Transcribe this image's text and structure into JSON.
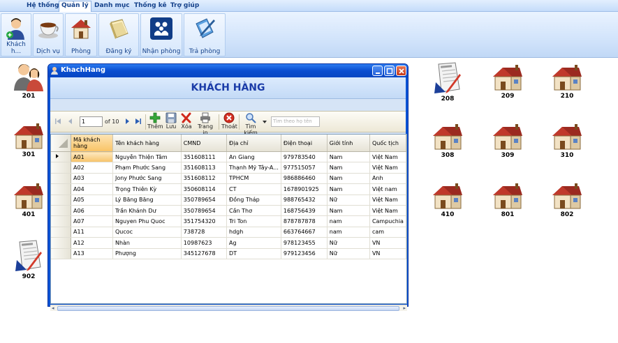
{
  "menu": [
    "Hệ thống",
    "Quản lý",
    "Danh mục",
    "Thống kê",
    "Trợ giúp"
  ],
  "menu_active": "Quản lý",
  "ribbon": [
    {
      "label": "Khách h...",
      "icon": "customer-add-icon"
    },
    {
      "label": "Dịch vụ",
      "icon": "coffee-cup-icon"
    },
    {
      "label": "Phòng",
      "icon": "house-icon"
    },
    {
      "label": "Đăng ký",
      "icon": "book-icon"
    },
    {
      "label": "Nhận phòng",
      "icon": "people-icon"
    },
    {
      "label": "Trả phòng",
      "icon": "pen-book-icon"
    }
  ],
  "rooms": {
    "r201": "201",
    "r301": "301",
    "r401": "401",
    "r902": "902",
    "r208": "208",
    "r209": "209",
    "r210": "210",
    "r308": "308",
    "r309": "309",
    "r310": "310",
    "r410": "410",
    "r801": "801",
    "r802": "802"
  },
  "window": {
    "title": "KhachHang",
    "heading": "KHÁCH HÀNG"
  },
  "navigator": {
    "position": "1",
    "count": "of 10",
    "add": "Thêm",
    "save": "Lưu",
    "delete": "Xóa",
    "print": "Trang in",
    "exit": "Thoát",
    "search": "Tìm kiếm",
    "search_placeholder": "Tìm theo họ tên"
  },
  "table": {
    "columns": [
      "Mã khách hàng",
      "Tên khách hàng",
      "CMND",
      "Địa chỉ",
      "Điện thoại",
      "Giới tính",
      "Quốc tịch"
    ],
    "rows": [
      [
        "A01",
        "Nguyễn Thiện Tâm",
        "351608111",
        "An Giang",
        "979783540",
        "Nam",
        "Việt Nam"
      ],
      [
        "A02",
        "Phạm Phước Sang",
        "351608113",
        "Thạnh Mỹ Tây-A...",
        "977515057",
        "Nam",
        "Việt Nam"
      ],
      [
        "A03",
        "Jony Phước Sang",
        "351608112",
        "TPHCM",
        "986886460",
        "Nam",
        "Anh"
      ],
      [
        "A04",
        "Trọng Thiên Kỳ",
        "350608114",
        "CT",
        "1678901925",
        "Nam",
        "Việt nam"
      ],
      [
        "A05",
        "Lý Băng Băng",
        "350789654",
        "Đồng Tháp",
        "988765432",
        "Nữ",
        "Việt Nam"
      ],
      [
        "A06",
        "Trần Khánh Dư",
        "350789654",
        "Cần Thơ",
        "168756439",
        "Nam",
        "Việt Nam"
      ],
      [
        "A07",
        "Nguyen Phu Quoc",
        "351754320",
        "Tri Ton",
        "878787878",
        "nam",
        "Campuchia"
      ],
      [
        "A11",
        "Qucoc",
        "738728",
        "hdgh",
        "663764667",
        "nam",
        "cam"
      ],
      [
        "A12",
        "Nhàn",
        "10987623",
        "Ag",
        "978123455",
        "Nữ",
        "VN"
      ],
      [
        "A13",
        "Phượng",
        "345127678",
        "DT",
        "979123456",
        "Nữ",
        "VN"
      ]
    ]
  }
}
